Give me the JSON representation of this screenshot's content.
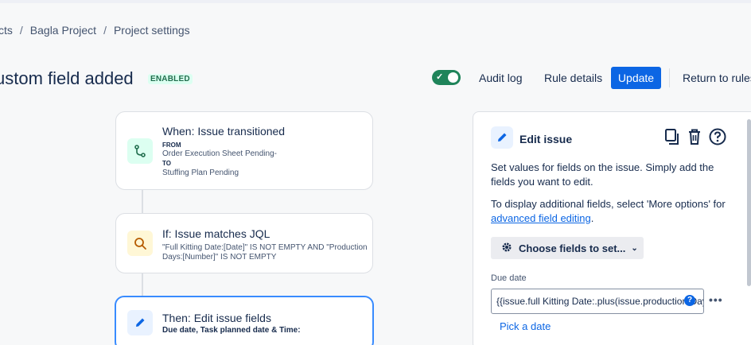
{
  "breadcrumb": {
    "item1": "cts",
    "item2": "Bagla Project",
    "item3": "Project settings",
    "sep": "/"
  },
  "header": {
    "title": "ustom field added",
    "badge": "ENABLED",
    "toggle_state": "on",
    "audit_log": "Audit log",
    "rule_details": "Rule details",
    "update": "Update",
    "return": "Return to rules"
  },
  "flow": {
    "trigger": {
      "title": "When: Issue transitioned",
      "from_label": "FROM",
      "from_value": "Order Execution Sheet Pending-",
      "to_label": "TO",
      "to_value": "Stuffing Plan Pending",
      "icon": "branch-icon"
    },
    "condition": {
      "title": "If: Issue matches JQL",
      "line1": "\"Full Kitting Date:[Date]\" IS NOT EMPTY AND \"Production",
      "line2": "Days:[Number]\" IS NOT EMPTY",
      "icon": "search-icon"
    },
    "action": {
      "title": "Then: Edit issue fields",
      "detail": "Due date, Task planned date & Time:",
      "icon": "pencil-icon"
    }
  },
  "panel": {
    "title": "Edit issue",
    "desc1": "Set values for fields on the issue. Simply add the fields you want to edit.",
    "desc2": "To display additional fields, select 'More options' for",
    "link": "advanced field editing",
    "period": ".",
    "choose": "Choose fields to set...",
    "field_label": "Due date",
    "field_value": "{{issue.full Kitting Date:.plus(issue.production Days",
    "pick": "Pick a date"
  },
  "colors": {
    "primary": "#0c66e4",
    "success": "#1f845a"
  }
}
